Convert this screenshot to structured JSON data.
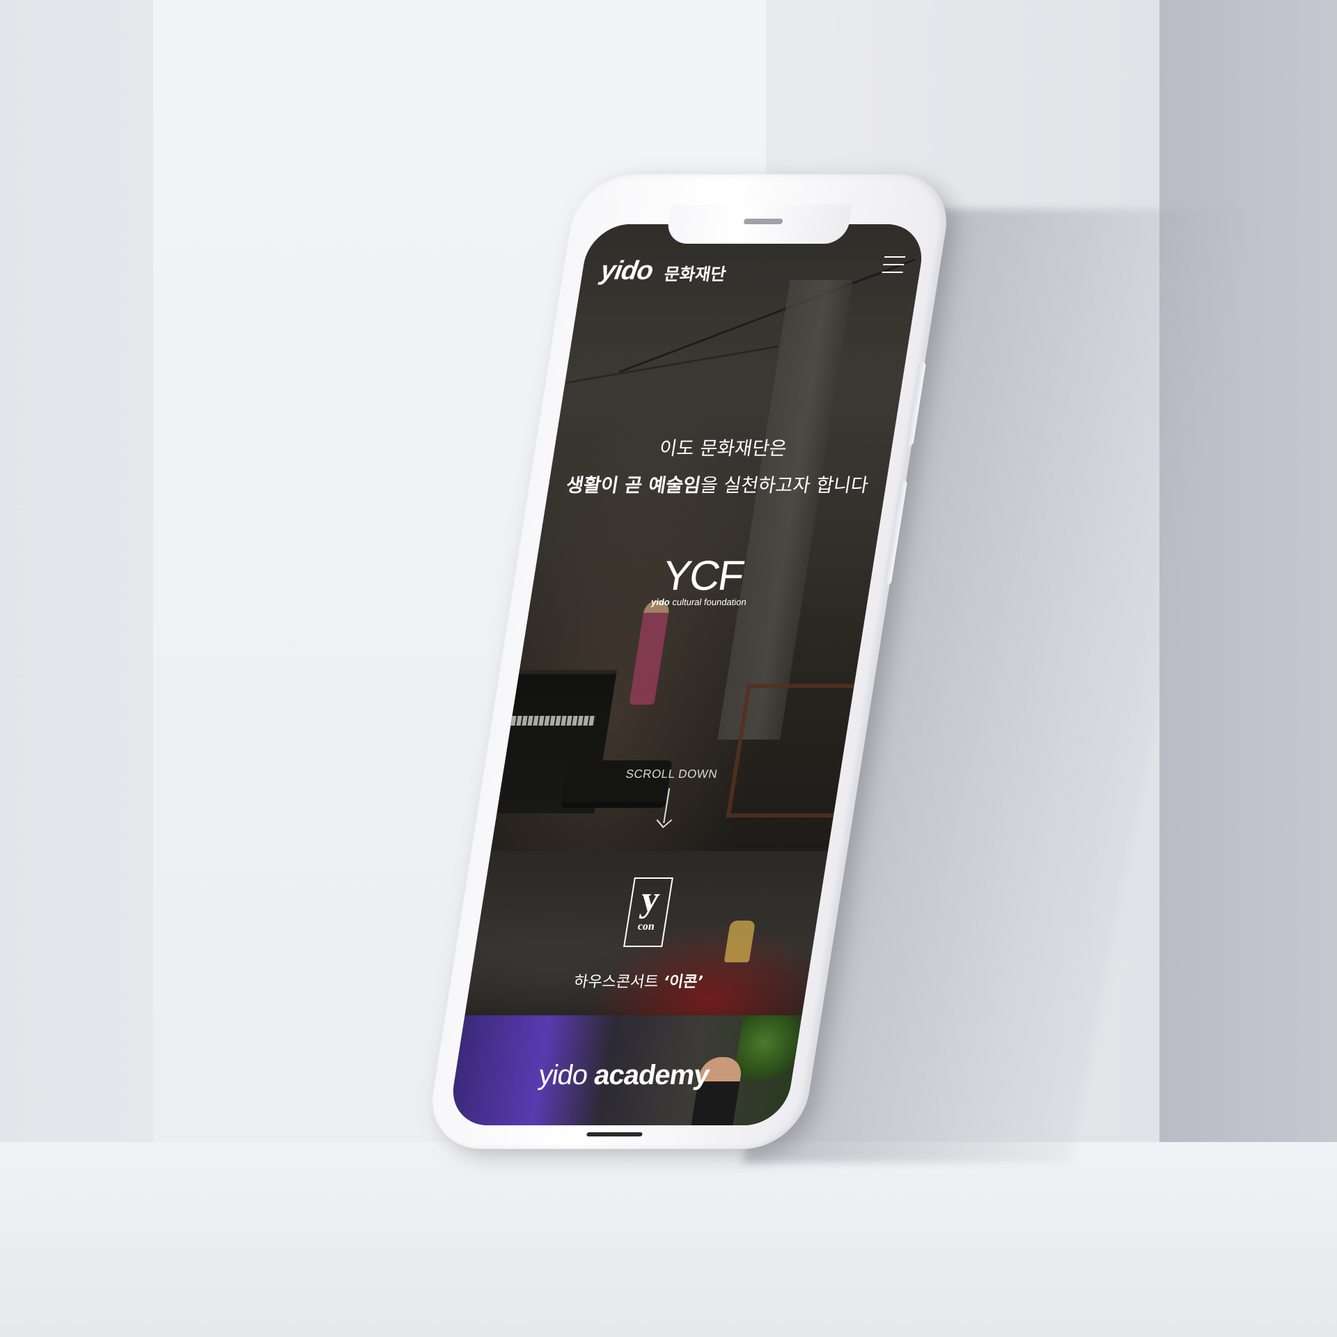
{
  "header": {
    "logo_text": "yido",
    "logo_kor": "문화재단",
    "menu_icon": "hamburger-icon"
  },
  "hero": {
    "line1": "이도 문화재단은",
    "line2_bold": "생활이 곧 예술임",
    "line2_rest": "을 실천하고자 합니다",
    "brand_mark": "YCF",
    "brand_sub_bold": "yido",
    "brand_sub_rest": "cultural foundation",
    "scroll_label": "SCROLL DOWN",
    "scroll_icon": "arrow-down-icon"
  },
  "concert": {
    "logo_y": "y",
    "logo_con": "con",
    "caption_plain": "하우스콘서트 ",
    "caption_bold": "‘이콘’"
  },
  "academy": {
    "title_light": "yido",
    "title_bold": "academy"
  },
  "colors": {
    "text": "#ffffff",
    "background_scene": "#e9eaee",
    "phone_body": "#f7f7f9"
  }
}
